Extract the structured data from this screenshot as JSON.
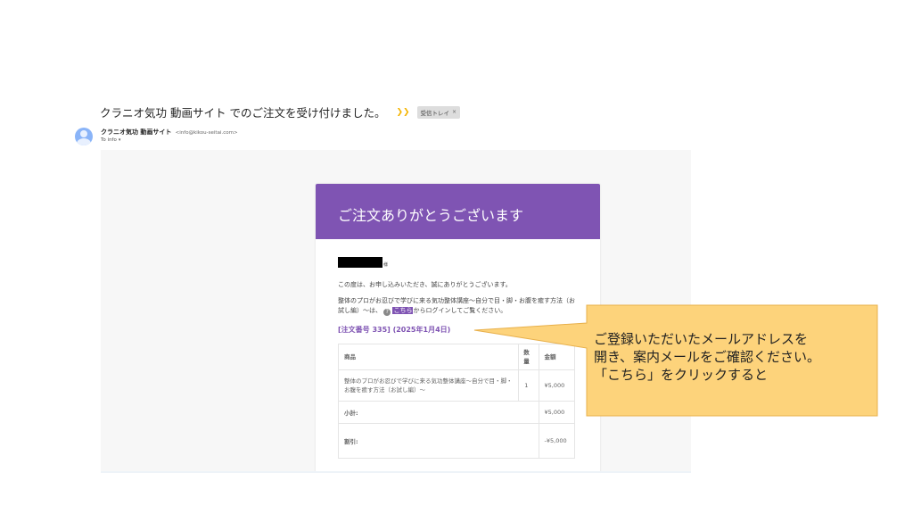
{
  "email": {
    "subject": "クラニオ気功 動画サイト でのご注文を受け付けました。",
    "label": "受信トレイ",
    "label_close": "×",
    "sender_name": "クラニオ気功 動画サイト",
    "sender_email": "<info@kikou-seitai.com>",
    "recipient": "To info",
    "recipient_caret": "▾"
  },
  "order": {
    "header": "ご注文ありがとうございます",
    "honorific": "様",
    "thanks": "この度は、お申し込みいただき、誠にありがとうございます。",
    "body_before": "整体のプロがお忍びで学びに来る気功整体講座〜自分で目・脚・お腹を癒す方法（お試し編）〜は、",
    "icon_glyph": "?",
    "link_text": "こちら",
    "body_after": "からログインしてご覧ください。",
    "order_title": "[注文番号 335] (2025年1月4日)",
    "table": {
      "headers": [
        "商品",
        "数量",
        "金額"
      ],
      "row": {
        "product": "整体のプロがお忍びで学びに来る気功整体講座〜自分で目・脚・お腹を癒す方法（お試し編）〜",
        "qty": "1",
        "price": "¥5,000"
      },
      "subtotal_label": "小計:",
      "subtotal_value": "¥5,000",
      "discount_label": "割引:",
      "discount_value": "-¥5,000"
    }
  },
  "callout": {
    "line1": "ご登録いただいたメールアドレスを",
    "line2": "開き、案内メールをご確認ください。",
    "line3": "「こちら」をクリックすると",
    "fill_color": "#fdd37b",
    "border_color": "#e8b04b"
  },
  "colors": {
    "brand": "#7f54b3"
  }
}
